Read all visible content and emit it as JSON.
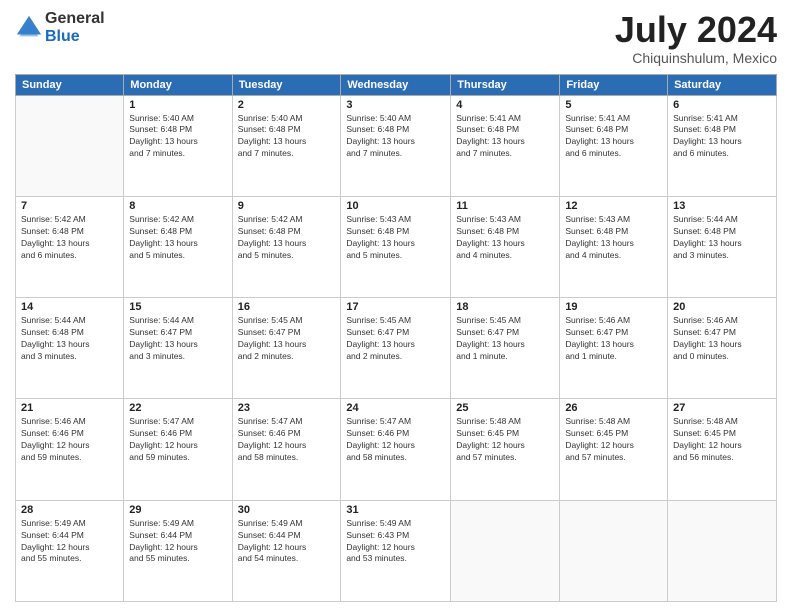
{
  "logo": {
    "general": "General",
    "blue": "Blue"
  },
  "title": "July 2024",
  "location": "Chiquinshulum, Mexico",
  "weekdays": [
    "Sunday",
    "Monday",
    "Tuesday",
    "Wednesday",
    "Thursday",
    "Friday",
    "Saturday"
  ],
  "weeks": [
    [
      {
        "day": "",
        "info": ""
      },
      {
        "day": "1",
        "info": "Sunrise: 5:40 AM\nSunset: 6:48 PM\nDaylight: 13 hours\nand 7 minutes."
      },
      {
        "day": "2",
        "info": "Sunrise: 5:40 AM\nSunset: 6:48 PM\nDaylight: 13 hours\nand 7 minutes."
      },
      {
        "day": "3",
        "info": "Sunrise: 5:40 AM\nSunset: 6:48 PM\nDaylight: 13 hours\nand 7 minutes."
      },
      {
        "day": "4",
        "info": "Sunrise: 5:41 AM\nSunset: 6:48 PM\nDaylight: 13 hours\nand 7 minutes."
      },
      {
        "day": "5",
        "info": "Sunrise: 5:41 AM\nSunset: 6:48 PM\nDaylight: 13 hours\nand 6 minutes."
      },
      {
        "day": "6",
        "info": "Sunrise: 5:41 AM\nSunset: 6:48 PM\nDaylight: 13 hours\nand 6 minutes."
      }
    ],
    [
      {
        "day": "7",
        "info": "Sunrise: 5:42 AM\nSunset: 6:48 PM\nDaylight: 13 hours\nand 6 minutes."
      },
      {
        "day": "8",
        "info": "Sunrise: 5:42 AM\nSunset: 6:48 PM\nDaylight: 13 hours\nand 5 minutes."
      },
      {
        "day": "9",
        "info": "Sunrise: 5:42 AM\nSunset: 6:48 PM\nDaylight: 13 hours\nand 5 minutes."
      },
      {
        "day": "10",
        "info": "Sunrise: 5:43 AM\nSunset: 6:48 PM\nDaylight: 13 hours\nand 5 minutes."
      },
      {
        "day": "11",
        "info": "Sunrise: 5:43 AM\nSunset: 6:48 PM\nDaylight: 13 hours\nand 4 minutes."
      },
      {
        "day": "12",
        "info": "Sunrise: 5:43 AM\nSunset: 6:48 PM\nDaylight: 13 hours\nand 4 minutes."
      },
      {
        "day": "13",
        "info": "Sunrise: 5:44 AM\nSunset: 6:48 PM\nDaylight: 13 hours\nand 3 minutes."
      }
    ],
    [
      {
        "day": "14",
        "info": "Sunrise: 5:44 AM\nSunset: 6:48 PM\nDaylight: 13 hours\nand 3 minutes."
      },
      {
        "day": "15",
        "info": "Sunrise: 5:44 AM\nSunset: 6:47 PM\nDaylight: 13 hours\nand 3 minutes."
      },
      {
        "day": "16",
        "info": "Sunrise: 5:45 AM\nSunset: 6:47 PM\nDaylight: 13 hours\nand 2 minutes."
      },
      {
        "day": "17",
        "info": "Sunrise: 5:45 AM\nSunset: 6:47 PM\nDaylight: 13 hours\nand 2 minutes."
      },
      {
        "day": "18",
        "info": "Sunrise: 5:45 AM\nSunset: 6:47 PM\nDaylight: 13 hours\nand 1 minute."
      },
      {
        "day": "19",
        "info": "Sunrise: 5:46 AM\nSunset: 6:47 PM\nDaylight: 13 hours\nand 1 minute."
      },
      {
        "day": "20",
        "info": "Sunrise: 5:46 AM\nSunset: 6:47 PM\nDaylight: 13 hours\nand 0 minutes."
      }
    ],
    [
      {
        "day": "21",
        "info": "Sunrise: 5:46 AM\nSunset: 6:46 PM\nDaylight: 12 hours\nand 59 minutes."
      },
      {
        "day": "22",
        "info": "Sunrise: 5:47 AM\nSunset: 6:46 PM\nDaylight: 12 hours\nand 59 minutes."
      },
      {
        "day": "23",
        "info": "Sunrise: 5:47 AM\nSunset: 6:46 PM\nDaylight: 12 hours\nand 58 minutes."
      },
      {
        "day": "24",
        "info": "Sunrise: 5:47 AM\nSunset: 6:46 PM\nDaylight: 12 hours\nand 58 minutes."
      },
      {
        "day": "25",
        "info": "Sunrise: 5:48 AM\nSunset: 6:45 PM\nDaylight: 12 hours\nand 57 minutes."
      },
      {
        "day": "26",
        "info": "Sunrise: 5:48 AM\nSunset: 6:45 PM\nDaylight: 12 hours\nand 57 minutes."
      },
      {
        "day": "27",
        "info": "Sunrise: 5:48 AM\nSunset: 6:45 PM\nDaylight: 12 hours\nand 56 minutes."
      }
    ],
    [
      {
        "day": "28",
        "info": "Sunrise: 5:49 AM\nSunset: 6:44 PM\nDaylight: 12 hours\nand 55 minutes."
      },
      {
        "day": "29",
        "info": "Sunrise: 5:49 AM\nSunset: 6:44 PM\nDaylight: 12 hours\nand 55 minutes."
      },
      {
        "day": "30",
        "info": "Sunrise: 5:49 AM\nSunset: 6:44 PM\nDaylight: 12 hours\nand 54 minutes."
      },
      {
        "day": "31",
        "info": "Sunrise: 5:49 AM\nSunset: 6:43 PM\nDaylight: 12 hours\nand 53 minutes."
      },
      {
        "day": "",
        "info": ""
      },
      {
        "day": "",
        "info": ""
      },
      {
        "day": "",
        "info": ""
      }
    ]
  ]
}
